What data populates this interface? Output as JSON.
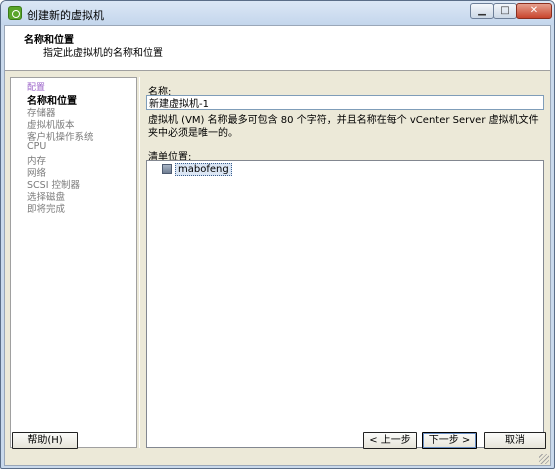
{
  "window": {
    "title": "创建新的虚拟机",
    "minimize_glyph": "▁",
    "maximize_glyph": "□",
    "close_glyph": "✕"
  },
  "header": {
    "title": "名称和位置",
    "subtitle": "指定此虚拟机的名称和位置"
  },
  "steps": [
    {
      "label": "配置",
      "state": "group"
    },
    {
      "label": "名称和位置",
      "state": "current"
    },
    {
      "label": "存储器",
      "state": "pending"
    },
    {
      "label": "虚拟机版本",
      "state": "pending"
    },
    {
      "label": "客户机操作系统",
      "state": "pending"
    },
    {
      "label": "CPU",
      "state": "pending"
    },
    {
      "label": "内存",
      "state": "pending"
    },
    {
      "label": "网络",
      "state": "pending"
    },
    {
      "label": "SCSI 控制器",
      "state": "pending"
    },
    {
      "label": "选择磁盘",
      "state": "pending"
    },
    {
      "label": "即将完成",
      "state": "pending"
    }
  ],
  "form": {
    "name_label": "名称:",
    "name_value": "新建虚拟机-1",
    "description": "虚拟机 (VM) 名称最多可包含 80 个字符，并且名称在每个 vCenter Server 虚拟机文件夹中必须是唯一的。",
    "inventory_label": "清单位置:",
    "inventory_items": [
      {
        "label": "mabofeng",
        "icon": "datacenter-icon",
        "selected": true
      }
    ]
  },
  "buttons": {
    "help": "帮助(H)",
    "back": "< 上一步",
    "next": "下一步 >",
    "cancel": "取消"
  }
}
